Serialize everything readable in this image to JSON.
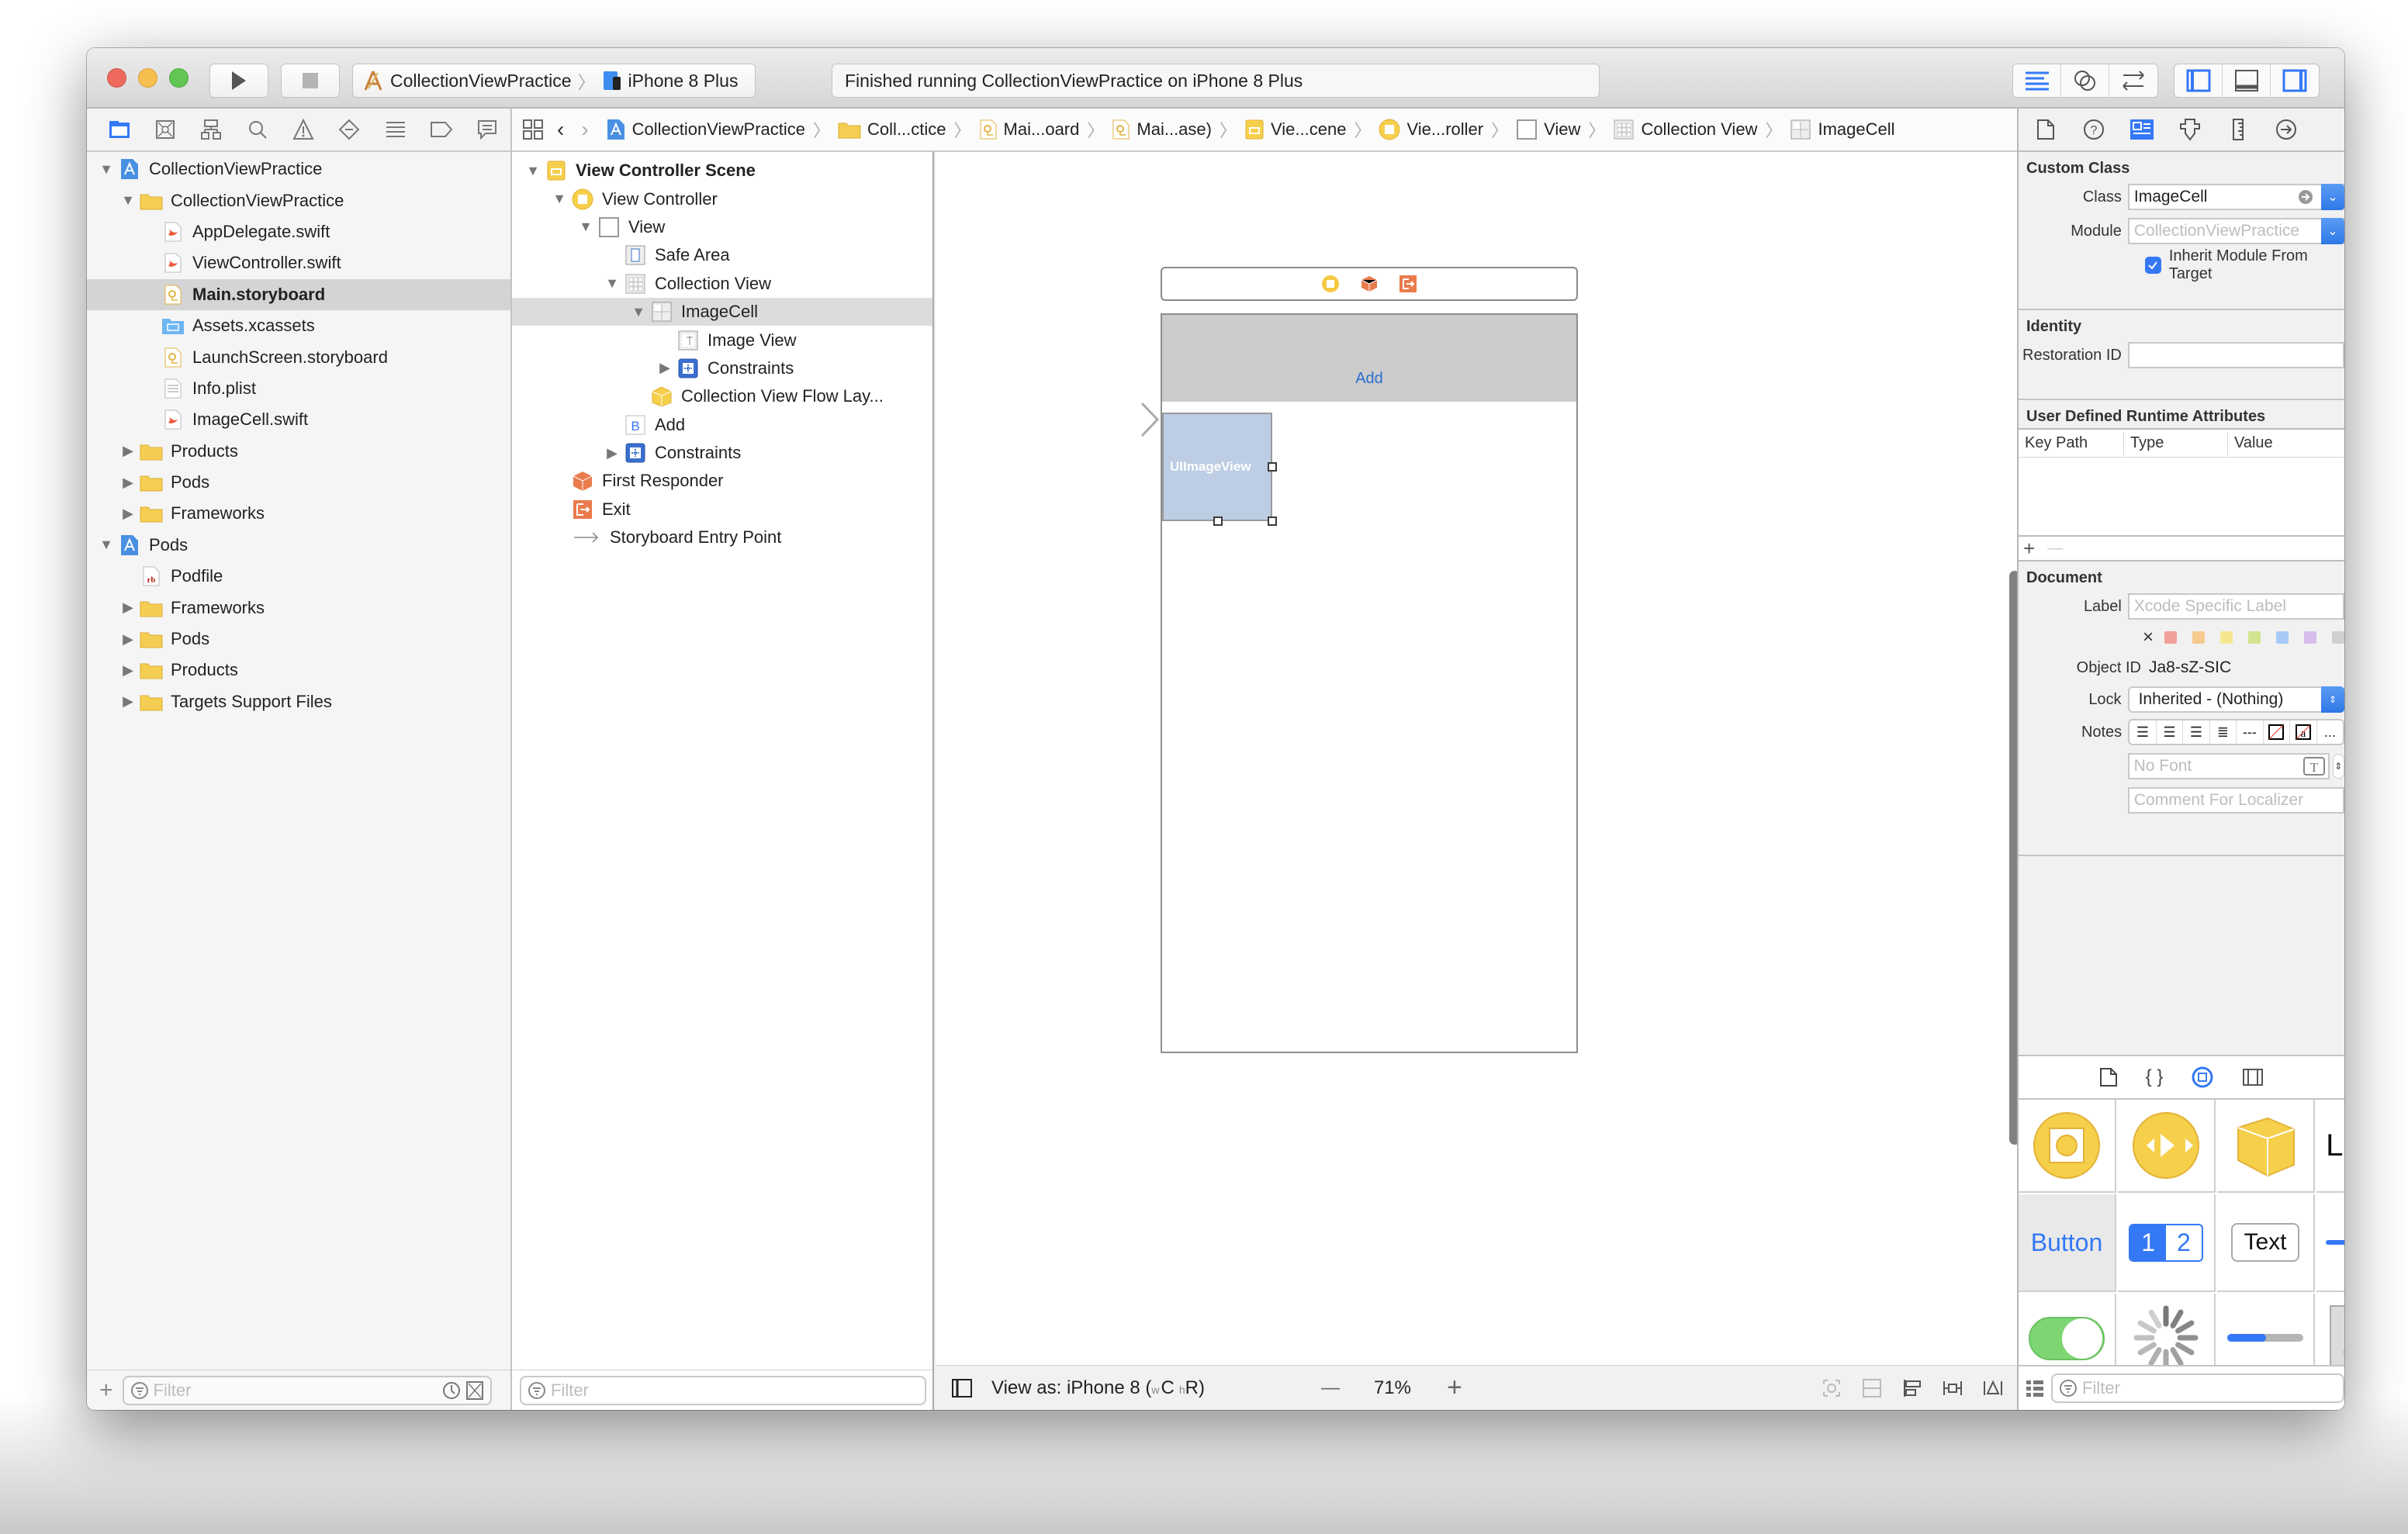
{
  "toolbar": {
    "scheme": "CollectionViewPractice",
    "destination": "iPhone 8 Plus",
    "status": "Finished running CollectionViewPractice on iPhone 8 Plus",
    "accent_color": "#3478f6"
  },
  "navigator": {
    "tabs": [
      "project-navigator",
      "source-control-navigator",
      "symbol-navigator",
      "find-navigator",
      "issue-navigator",
      "test-navigator",
      "debug-navigator",
      "breakpoint-navigator",
      "report-navigator"
    ],
    "items": [
      {
        "label": "CollectionViewPractice",
        "depth": 0,
        "icon": "project-icon",
        "disclosure": "open"
      },
      {
        "label": "CollectionViewPractice",
        "depth": 1,
        "icon": "folder-icon",
        "disclosure": "open"
      },
      {
        "label": "AppDelegate.swift",
        "depth": 2,
        "icon": "swift-file-icon",
        "disclosure": "none"
      },
      {
        "label": "ViewController.swift",
        "depth": 2,
        "icon": "swift-file-icon",
        "disclosure": "none"
      },
      {
        "label": "Main.storyboard",
        "depth": 2,
        "icon": "storyboard-file-icon",
        "disclosure": "none",
        "selected": true
      },
      {
        "label": "Assets.xcassets",
        "depth": 2,
        "icon": "asset-catalog-icon",
        "disclosure": "none"
      },
      {
        "label": "LaunchScreen.storyboard",
        "depth": 2,
        "icon": "storyboard-file-icon",
        "disclosure": "none"
      },
      {
        "label": "Info.plist",
        "depth": 2,
        "icon": "plist-file-icon",
        "disclosure": "none"
      },
      {
        "label": "ImageCell.swift",
        "depth": 2,
        "icon": "swift-file-icon",
        "disclosure": "none"
      },
      {
        "label": "Products",
        "depth": 1,
        "icon": "folder-icon",
        "disclosure": "closed"
      },
      {
        "label": "Pods",
        "depth": 1,
        "icon": "folder-icon",
        "disclosure": "closed"
      },
      {
        "label": "Frameworks",
        "depth": 1,
        "icon": "folder-icon",
        "disclosure": "closed"
      },
      {
        "label": "Pods",
        "depth": 0,
        "icon": "project-icon",
        "disclosure": "open"
      },
      {
        "label": "Podfile",
        "depth": 1,
        "icon": "ruby-file-icon",
        "disclosure": "none"
      },
      {
        "label": "Frameworks",
        "depth": 1,
        "icon": "folder-icon",
        "disclosure": "closed"
      },
      {
        "label": "Pods",
        "depth": 1,
        "icon": "folder-icon",
        "disclosure": "closed"
      },
      {
        "label": "Products",
        "depth": 1,
        "icon": "folder-icon",
        "disclosure": "closed"
      },
      {
        "label": "Targets Support Files",
        "depth": 1,
        "icon": "folder-icon",
        "disclosure": "closed"
      }
    ],
    "filter_placeholder": "Filter"
  },
  "jumpbar": {
    "crumbs": [
      {
        "label": "CollectionViewPractice",
        "icon": "project-icon"
      },
      {
        "label": "Coll...ctice",
        "icon": "folder-icon"
      },
      {
        "label": "Mai...oard",
        "icon": "storyboard-file-icon"
      },
      {
        "label": "Mai...ase)",
        "icon": "storyboard-file-icon"
      },
      {
        "label": "Vie...cene",
        "icon": "scene-icon"
      },
      {
        "label": "Vie...roller",
        "icon": "view-controller-icon"
      },
      {
        "label": "View",
        "icon": "view-icon"
      },
      {
        "label": "Collection View",
        "icon": "collection-view-icon"
      },
      {
        "label": "ImageCell",
        "icon": "collection-cell-icon"
      }
    ]
  },
  "outline": {
    "items": [
      {
        "label": "View Controller Scene",
        "depth": 0,
        "icon": "scene-icon",
        "disclosure": "open",
        "bold": true
      },
      {
        "label": "View Controller",
        "depth": 1,
        "icon": "view-controller-icon",
        "disclosure": "open"
      },
      {
        "label": "View",
        "depth": 2,
        "icon": "view-icon",
        "disclosure": "open"
      },
      {
        "label": "Safe Area",
        "depth": 3,
        "icon": "safe-area-icon",
        "disclosure": "none"
      },
      {
        "label": "Collection View",
        "depth": 3,
        "icon": "collection-view-icon",
        "disclosure": "open"
      },
      {
        "label": "ImageCell",
        "depth": 4,
        "icon": "collection-cell-icon",
        "disclosure": "open",
        "selected": true
      },
      {
        "label": "Image View",
        "depth": 5,
        "icon": "image-view-icon",
        "disclosure": "none"
      },
      {
        "label": "Constraints",
        "depth": 5,
        "icon": "constraints-icon",
        "disclosure": "closed"
      },
      {
        "label": "Collection View Flow Lay...",
        "depth": 4,
        "icon": "flow-layout-icon",
        "disclosure": "none"
      },
      {
        "label": "Add",
        "depth": 3,
        "icon": "button-icon",
        "disclosure": "none"
      },
      {
        "label": "Constraints",
        "depth": 3,
        "icon": "constraints-icon",
        "disclosure": "closed"
      },
      {
        "label": "First Responder",
        "depth": 1,
        "icon": "first-responder-icon",
        "disclosure": "none"
      },
      {
        "label": "Exit",
        "depth": 1,
        "icon": "exit-icon",
        "disclosure": "none"
      },
      {
        "label": "Storyboard Entry Point",
        "depth": 1,
        "icon": "entry-point-icon",
        "disclosure": "none"
      }
    ],
    "filter_placeholder": "Filter"
  },
  "canvas": {
    "add_button": "Add",
    "image_view_label": "UIImageView",
    "view_as": "View as: iPhone 8 (",
    "size_class_w": "w",
    "size_class_w_val": "C",
    "size_class_h": "h",
    "size_class_h_val": "R)",
    "zoom_level": "71%",
    "zoom_out": "—",
    "zoom_in": "+"
  },
  "inspector": {
    "custom_class": {
      "title": "Custom Class",
      "class_label": "Class",
      "class_value": "ImageCell",
      "module_label": "Module",
      "module_placeholder": "CollectionViewPractice",
      "inherit_label": "Inherit Module From Target",
      "inherit_checked": true
    },
    "identity": {
      "title": "Identity",
      "restoration_label": "Restoration ID",
      "restoration_value": ""
    },
    "runtime_attributes": {
      "title": "User Defined Runtime Attributes",
      "columns": [
        "Key Path",
        "Type",
        "Value"
      ],
      "rows": [],
      "add": "+",
      "remove": "—"
    },
    "document": {
      "title": "Document",
      "label_label": "Label",
      "label_placeholder": "Xcode Specific Label",
      "clear_color": "×",
      "label_colors": [
        "#f1a19a",
        "#f6c98f",
        "#f6e68f",
        "#d2e48f",
        "#a7cbf6",
        "#d6bdec",
        "#cfcfcf"
      ],
      "object_id_label": "Object ID",
      "object_id": "Ja8-sZ-SIC",
      "lock_label": "Lock",
      "lock_value": "Inherited - (Nothing)",
      "notes_label": "Notes",
      "notes_more": "...",
      "font_placeholder": "No Font",
      "comment_placeholder": "Comment For Localizer"
    },
    "library": {
      "tabs": [
        "file-template-library",
        "code-snippet-library",
        "object-library",
        "media-library"
      ],
      "items": [
        "View Controller",
        "AV Player",
        "Object",
        "Label",
        "Button",
        "Segmented Control",
        "Text Field",
        "Slider",
        "Switch",
        "Activity Indicator",
        "Progress View",
        "Page Control"
      ],
      "label_text": "Label",
      "button_text": "Button",
      "segment_1": "1",
      "segment_2": "2",
      "text_field_text": "Text",
      "filter_placeholder": "Filter"
    }
  }
}
